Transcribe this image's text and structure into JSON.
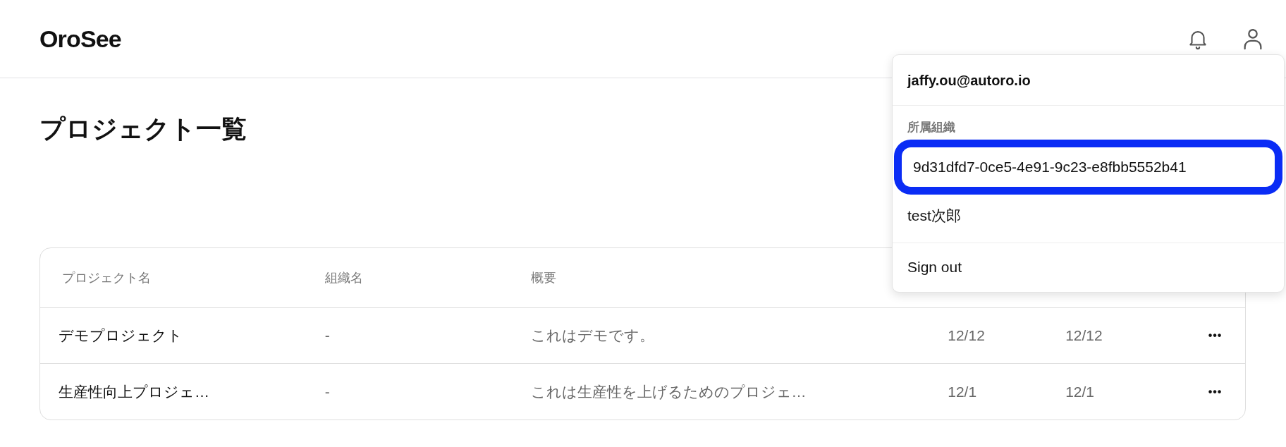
{
  "header": {
    "logo": "OroSee"
  },
  "page": {
    "title": "プロジェクト一覧"
  },
  "table": {
    "columns": [
      "プロジェクト名",
      "組織名",
      "概要"
    ],
    "rows": [
      {
        "name": "デモプロジェクト",
        "org": "-",
        "summary": "これはデモです。",
        "created": "12/12",
        "updated": "12/12",
        "menu": "•••"
      },
      {
        "name": "生産性向上プロジェ…",
        "org": "-",
        "summary": "これは生産性を上げるためのプロジェ…",
        "created": "12/1",
        "updated": "12/1",
        "menu": "•••"
      }
    ]
  },
  "user_menu": {
    "email": "jaffy.ou@autoro.io",
    "section_label": "所属組織",
    "organizations": [
      {
        "label": "9d31dfd7-0ce5-4e91-9c23-e8fbb5552b41",
        "highlighted": true
      },
      {
        "label": "test次郎",
        "highlighted": false
      }
    ],
    "sign_out": "Sign out"
  }
}
